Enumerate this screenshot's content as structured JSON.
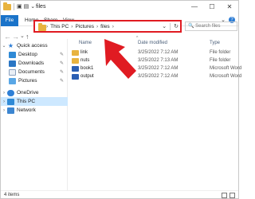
{
  "window": {
    "title": "files",
    "controls": {
      "minimize": "—",
      "maximize": "☐",
      "close": "✕"
    }
  },
  "ribbon": {
    "file_tab": "File",
    "tabs": [
      "Home",
      "Share",
      "View"
    ],
    "expand_glyph": "⌄",
    "help_glyph": "?"
  },
  "nav": {
    "back": "←",
    "forward": "→",
    "recent": "⌄",
    "up": "↑",
    "breadcrumbs": [
      "This PC",
      "Pictures",
      "files"
    ],
    "dropdown_glyph": "⌄",
    "refresh_glyph": "↻",
    "search_placeholder": "🔍 Search files"
  },
  "sidebar": {
    "items": [
      {
        "label": "Quick access",
        "icon": "star-icon",
        "pinned": false
      },
      {
        "label": "Desktop",
        "icon": "desktop-icon",
        "pinned": true
      },
      {
        "label": "Downloads",
        "icon": "downloads-icon",
        "pinned": true
      },
      {
        "label": "Documents",
        "icon": "documents-icon",
        "pinned": true
      },
      {
        "label": "Pictures",
        "icon": "pictures-icon",
        "pinned": true
      },
      {
        "label": "OneDrive",
        "icon": "cloud-icon",
        "pinned": false
      },
      {
        "label": "This PC",
        "icon": "computer-icon",
        "pinned": false,
        "selected": true
      },
      {
        "label": "Network",
        "icon": "network-icon",
        "pinned": false
      }
    ],
    "pin_glyph": "📌"
  },
  "columns": {
    "name": "Name",
    "date_modified": "Date modified",
    "type": "Type"
  },
  "files": [
    {
      "name": "link",
      "date": "3/25/2022 7:12 AM",
      "type": "File folder",
      "kind": "folder"
    },
    {
      "name": "nuts",
      "date": "3/25/2022 7:13 AM",
      "type": "File folder",
      "kind": "folder"
    },
    {
      "name": "book1",
      "date": "3/25/2022 7:12 AM",
      "type": "Microsoft Word",
      "kind": "word"
    },
    {
      "name": "output",
      "date": "3/25/2022 7:12 AM",
      "type": "Microsoft Word",
      "kind": "word"
    }
  ],
  "status": {
    "item_count": "4 items"
  },
  "annotation": {
    "arrow_color": "#e01b22"
  }
}
